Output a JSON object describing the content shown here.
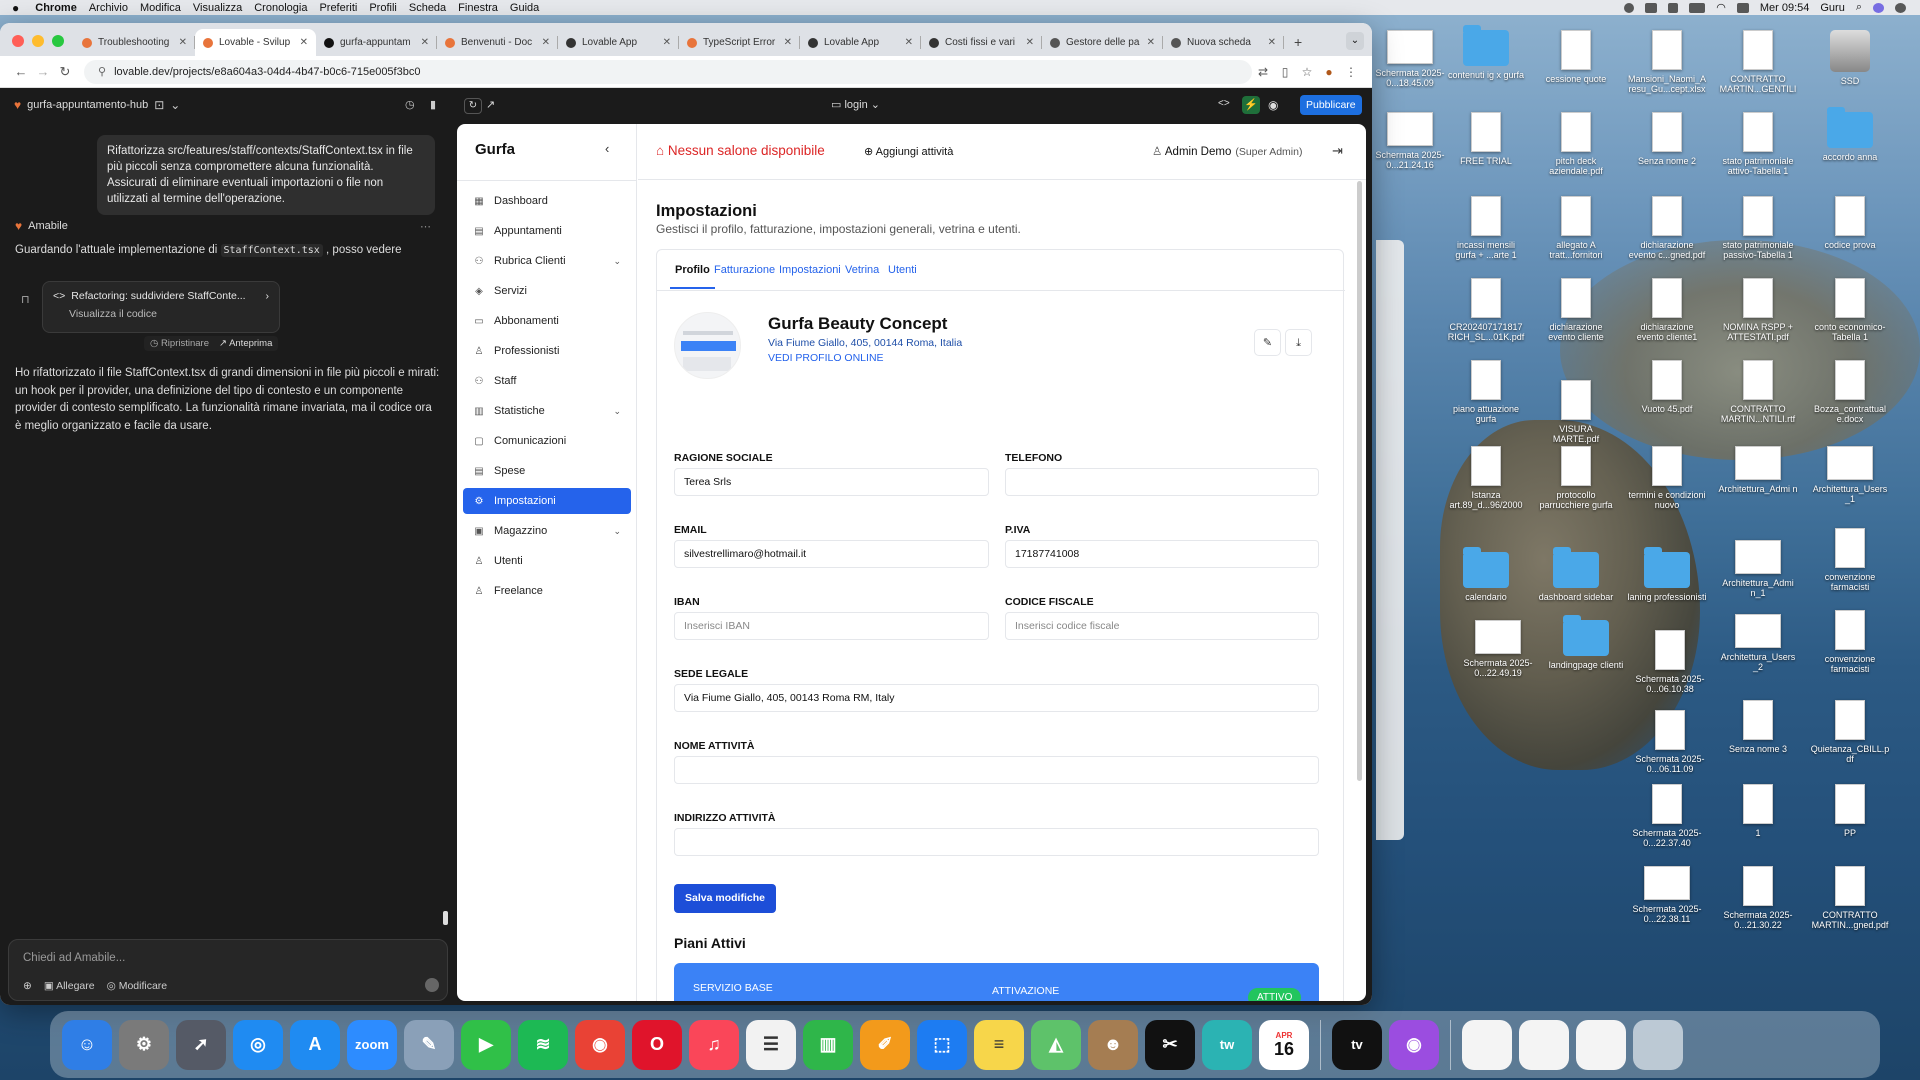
{
  "menubar": {
    "app": "Chrome",
    "items": [
      "Archivio",
      "Modifica",
      "Visualizza",
      "Cronologia",
      "Preferiti",
      "Profili",
      "Scheda",
      "Finestra",
      "Guida"
    ],
    "clock": "Mer 09:54",
    "user": "Guru"
  },
  "browser": {
    "tabs": [
      {
        "label": "Troubleshooting",
        "color": "#e8743b",
        "active": false
      },
      {
        "label": "Lovable - Svilup",
        "color": "#e8743b",
        "active": true
      },
      {
        "label": "gurfa-appuntam",
        "color": "#111111",
        "active": false
      },
      {
        "label": "Benvenuti - Doc",
        "color": "#e8743b",
        "active": false
      },
      {
        "label": "Lovable App",
        "color": "#333333",
        "active": false
      },
      {
        "label": "TypeScript Error",
        "color": "#e8743b",
        "active": false
      },
      {
        "label": "Lovable App",
        "color": "#333333",
        "active": false
      },
      {
        "label": "Costi fissi e vari",
        "color": "#333333",
        "active": false
      },
      {
        "label": "Gestore delle pa",
        "color": "#555555",
        "active": false
      },
      {
        "label": "Nuova scheda",
        "color": "#555555",
        "active": false
      }
    ],
    "url": "lovable.dev/projects/e8a604a3-04d4-4b47-b0c6-715e005f3bc0"
  },
  "lovable": {
    "project": "gurfa-appuntamento-hub",
    "route": "login",
    "publish_label": "Pubblicare",
    "user_message": "Rifattorizza src/features/staff/contexts/StaffContext.tsx in file più piccoli senza compromettere alcuna funzionalità. Assicurati di eliminare eventuali importazioni o file non utilizzati al termine dell'operazione.",
    "assistant_name": "Amabile",
    "reply_intro": "Guardando l'attuale implementazione di",
    "reply_code": "StaffContext.tsx",
    "reply_intro_end": ", posso vedere",
    "refactor_card_title": "Refactoring: suddividere StaffConte...",
    "refactor_card_sub": "Visualizza il codice",
    "restore_label": "Ripristinare",
    "preview_label": "Anteprima",
    "reply_body": "Ho rifattorizzato il file StaffContext.tsx di grandi dimensioni in file più piccoli e mirati: un hook per il provider, una definizione del tipo di contesto e un componente provider di contesto semplificato. La funzionalità rimane invariata, ma il codice ora è meglio organizzato e facile da usare.",
    "chat_placeholder": "Chiedi ad Amabile...",
    "attach_label": "Allegare",
    "edit_label": "Modificare"
  },
  "app": {
    "brand": "Gurfa",
    "nav": [
      {
        "label": "Dashboard",
        "icon": "grid-icon",
        "glyph": "▦",
        "chev": false,
        "active": false
      },
      {
        "label": "Appuntamenti",
        "icon": "calendar-icon",
        "glyph": "▤",
        "chev": false,
        "active": false
      },
      {
        "label": "Rubrica Clienti",
        "icon": "users-icon",
        "glyph": "⚇",
        "chev": true,
        "active": false
      },
      {
        "label": "Servizi",
        "icon": "package-icon",
        "glyph": "◈",
        "chev": false,
        "active": false
      },
      {
        "label": "Abbonamenti",
        "icon": "card-icon",
        "glyph": "▭",
        "chev": false,
        "active": false
      },
      {
        "label": "Professionisti",
        "icon": "user-icon",
        "glyph": "♙",
        "chev": false,
        "active": false
      },
      {
        "label": "Staff",
        "icon": "staff-icon",
        "glyph": "⚇",
        "chev": false,
        "active": false
      },
      {
        "label": "Statistiche",
        "icon": "chart-icon",
        "glyph": "▥",
        "chev": true,
        "active": false
      },
      {
        "label": "Comunicazioni",
        "icon": "message-icon",
        "glyph": "▢",
        "chev": false,
        "active": false
      },
      {
        "label": "Spese",
        "icon": "receipt-icon",
        "glyph": "▤",
        "chev": false,
        "active": false
      },
      {
        "label": "Impostazioni",
        "icon": "settings-icon",
        "glyph": "⚙",
        "chev": false,
        "active": true
      },
      {
        "label": "Magazzino",
        "icon": "box-icon",
        "glyph": "▣",
        "chev": true,
        "active": false
      },
      {
        "label": "Utenti",
        "icon": "user-icon",
        "glyph": "♙",
        "chev": false,
        "active": false
      },
      {
        "label": "Freelance",
        "icon": "user-icon",
        "glyph": "♙",
        "chev": false,
        "active": false
      }
    ],
    "header": {
      "no_salon": "Nessun salone disponibile",
      "add_activity": "Aggiungi attività",
      "admin_name": "Admin Demo",
      "admin_role": "(Super Admin)"
    },
    "page_title": "Impostazioni",
    "page_subtitle": "Gestisci il profilo, fatturazione, impostazioni generali, vetrina e utenti.",
    "tabs": [
      "Profilo",
      "Fatturazione",
      "Impostazioni",
      "Vetrina",
      "Utenti"
    ],
    "business": {
      "name": "Gurfa Beauty Concept",
      "address": "Via Fiume Giallo, 405, 00144 Roma, Italia",
      "view_online": "VEDI PROFILO ONLINE"
    },
    "form": {
      "ragione_label": "RAGIONE SOCIALE",
      "ragione_value": "Terea Srls",
      "telefono_label": "TELEFONO",
      "telefono_value": "",
      "email_label": "EMAIL",
      "email_value": "silvestrellimaro@hotmail.it",
      "piva_label": "P.IVA",
      "piva_value": "17187741008",
      "iban_label": "IBAN",
      "iban_placeholder": "Inserisci IBAN",
      "cf_label": "CODICE FISCALE",
      "cf_placeholder": "Inserisci codice fiscale",
      "sede_label": "SEDE LEGALE",
      "sede_value": "Via Fiume Giallo, 405, 00143 Roma RM, Italy",
      "nome_label": "NOME ATTIVITÀ",
      "nome_value": "",
      "indirizzo_label": "INDIRIZZO ATTIVITÀ",
      "indirizzo_value": ""
    },
    "save_label": "Salva modifiche",
    "plans_title": "Piani Attivi",
    "plan": {
      "name": "SERVIZIO BASE",
      "activation_label": "ATTIVAZIONE",
      "status": "ATTIVO"
    }
  },
  "desktop": {
    "icons": [
      {
        "label": "Schermata 2025-0...18.45.09",
        "kind": "shot"
      },
      {
        "label": "contenuti ig x gurfa",
        "kind": "folder"
      },
      {
        "label": "cessione quote",
        "kind": "doc"
      },
      {
        "label": "Mansioni_Naomi_A resu_Gu...cept.xlsx",
        "kind": "doc"
      },
      {
        "label": "CONTRATTO MARTIN...GENTILI",
        "kind": "doc"
      },
      {
        "label": "SSD",
        "kind": "disk"
      },
      {
        "label": "Schermata 2025-0...21.24.16",
        "kind": "shot"
      },
      {
        "label": "FREE TRIAL",
        "kind": "doc"
      },
      {
        "label": "pitch deck aziendale.pdf",
        "kind": "doc"
      },
      {
        "label": "Senza nome 2",
        "kind": "doc"
      },
      {
        "label": "stato patrimoniale attivo-Tabella 1",
        "kind": "doc"
      },
      {
        "label": "accordo anna",
        "kind": "folder"
      },
      {
        "label": "incassi mensili gurfa + ...arte 1",
        "kind": "doc"
      },
      {
        "label": "allegato A tratt...fornitori",
        "kind": "doc"
      },
      {
        "label": "dichiarazione evento c...gned.pdf",
        "kind": "doc"
      },
      {
        "label": "stato patrimoniale passivo-Tabella 1",
        "kind": "doc"
      },
      {
        "label": "codice prova",
        "kind": "doc"
      },
      {
        "label": "CR202407171817 RICH_SL...01K.pdf",
        "kind": "doc"
      },
      {
        "label": "dichiarazione evento cliente",
        "kind": "doc"
      },
      {
        "label": "dichiarazione evento cliente1",
        "kind": "doc"
      },
      {
        "label": "NOMINA RSPP + ATTESTATI.pdf",
        "kind": "doc"
      },
      {
        "label": "conto economico-Tabella 1",
        "kind": "doc"
      },
      {
        "label": "piano attuazione gurfa",
        "kind": "doc"
      },
      {
        "label": "VISURA MARTE.pdf",
        "kind": "doc"
      },
      {
        "label": "Vuoto 45.pdf",
        "kind": "doc"
      },
      {
        "label": "CONTRATTO MARTIN...NTILI.rtf",
        "kind": "doc"
      },
      {
        "label": "Bozza_contrattual e.docx",
        "kind": "doc"
      },
      {
        "label": "Istanza art.89_d...96/2000",
        "kind": "doc"
      },
      {
        "label": "protocollo parrucchiere gurfa",
        "kind": "doc"
      },
      {
        "label": "termini e condizioni nuovo",
        "kind": "doc"
      },
      {
        "label": "Architettura_Admi n",
        "kind": "shot"
      },
      {
        "label": "Architettura_Users _1",
        "kind": "shot"
      },
      {
        "label": "calendario",
        "kind": "folder"
      },
      {
        "label": "dashboard sidebar",
        "kind": "folder"
      },
      {
        "label": "laning professionisti",
        "kind": "folder"
      },
      {
        "label": "Architettura_Admi n_1",
        "kind": "shot"
      },
      {
        "label": "convenzione farmacisti",
        "kind": "doc"
      },
      {
        "label": "Schermata 2025-0...22.49.19",
        "kind": "shot"
      },
      {
        "label": "landingpage clienti",
        "kind": "folder"
      },
      {
        "label": "Schermata 2025-0...06.10.38",
        "kind": "doc"
      },
      {
        "label": "Architettura_Users _2",
        "kind": "shot"
      },
      {
        "label": "convenzione farmacisti",
        "kind": "doc"
      },
      {
        "label": "Schermata 2025-0...06.11.09",
        "kind": "doc"
      },
      {
        "label": "Senza nome 3",
        "kind": "doc"
      },
      {
        "label": "Quietanza_CBILL.p df",
        "kind": "doc"
      },
      {
        "label": "Schermata 2025-0...22.37.40",
        "kind": "doc"
      },
      {
        "label": "1",
        "kind": "doc"
      },
      {
        "label": "PP",
        "kind": "doc"
      },
      {
        "label": "Schermata 2025-0...22.38.11",
        "kind": "shot"
      },
      {
        "label": "Schermata 2025-0...21.30.22",
        "kind": "doc"
      },
      {
        "label": "CONTRATTO MARTIN...gned.pdf",
        "kind": "doc"
      }
    ]
  },
  "dock": {
    "apps": [
      {
        "name": "finder",
        "glyph": "☺",
        "color": "#2f7ee6"
      },
      {
        "name": "system-settings",
        "glyph": "⚙",
        "color": "#7a7a7a"
      },
      {
        "name": "launchpad",
        "glyph": "➚",
        "color": "#555a66"
      },
      {
        "name": "safari",
        "glyph": "◎",
        "color": "#1f8bf2"
      },
      {
        "name": "app-store",
        "glyph": "A",
        "color": "#1f8bf2"
      },
      {
        "name": "zoom",
        "glyph": "zoom",
        "color": "#2d8cff"
      },
      {
        "name": "preview",
        "glyph": "✎",
        "color": "#8aa0b8"
      },
      {
        "name": "facetime",
        "glyph": "▶",
        "color": "#30c048"
      },
      {
        "name": "spotify",
        "glyph": "≋",
        "color": "#1db954"
      },
      {
        "name": "chrome",
        "glyph": "◉",
        "color": "#e94235"
      },
      {
        "name": "opera",
        "glyph": "O",
        "color": "#e0142b"
      },
      {
        "name": "music",
        "glyph": "♫",
        "color": "#fa4659"
      },
      {
        "name": "reminders",
        "glyph": "☰",
        "color": "#f2f2f2"
      },
      {
        "name": "numbers",
        "glyph": "▥",
        "color": "#2fb64a"
      },
      {
        "name": "pages",
        "glyph": "✐",
        "color": "#f39a1b"
      },
      {
        "name": "keynote",
        "glyph": "⬚",
        "color": "#1d7cf2"
      },
      {
        "name": "notes",
        "glyph": "≡",
        "color": "#f7d64a"
      },
      {
        "name": "maps",
        "glyph": "◭",
        "color": "#5ec26a"
      },
      {
        "name": "contacts",
        "glyph": "☻",
        "color": "#a57d52"
      },
      {
        "name": "capcut",
        "glyph": "✂",
        "color": "#111111"
      },
      {
        "name": "tw-pro",
        "glyph": "tw",
        "color": "#2bb3b3"
      },
      {
        "name": "calendar",
        "glyph": "16",
        "color": "#ffffff"
      },
      {
        "name": "apple-tv",
        "glyph": "tv",
        "color": "#111111"
      },
      {
        "name": "podcasts",
        "glyph": "◉",
        "color": "#9b4de0"
      }
    ],
    "calendar_month": "APR",
    "calendar_day": "16"
  }
}
